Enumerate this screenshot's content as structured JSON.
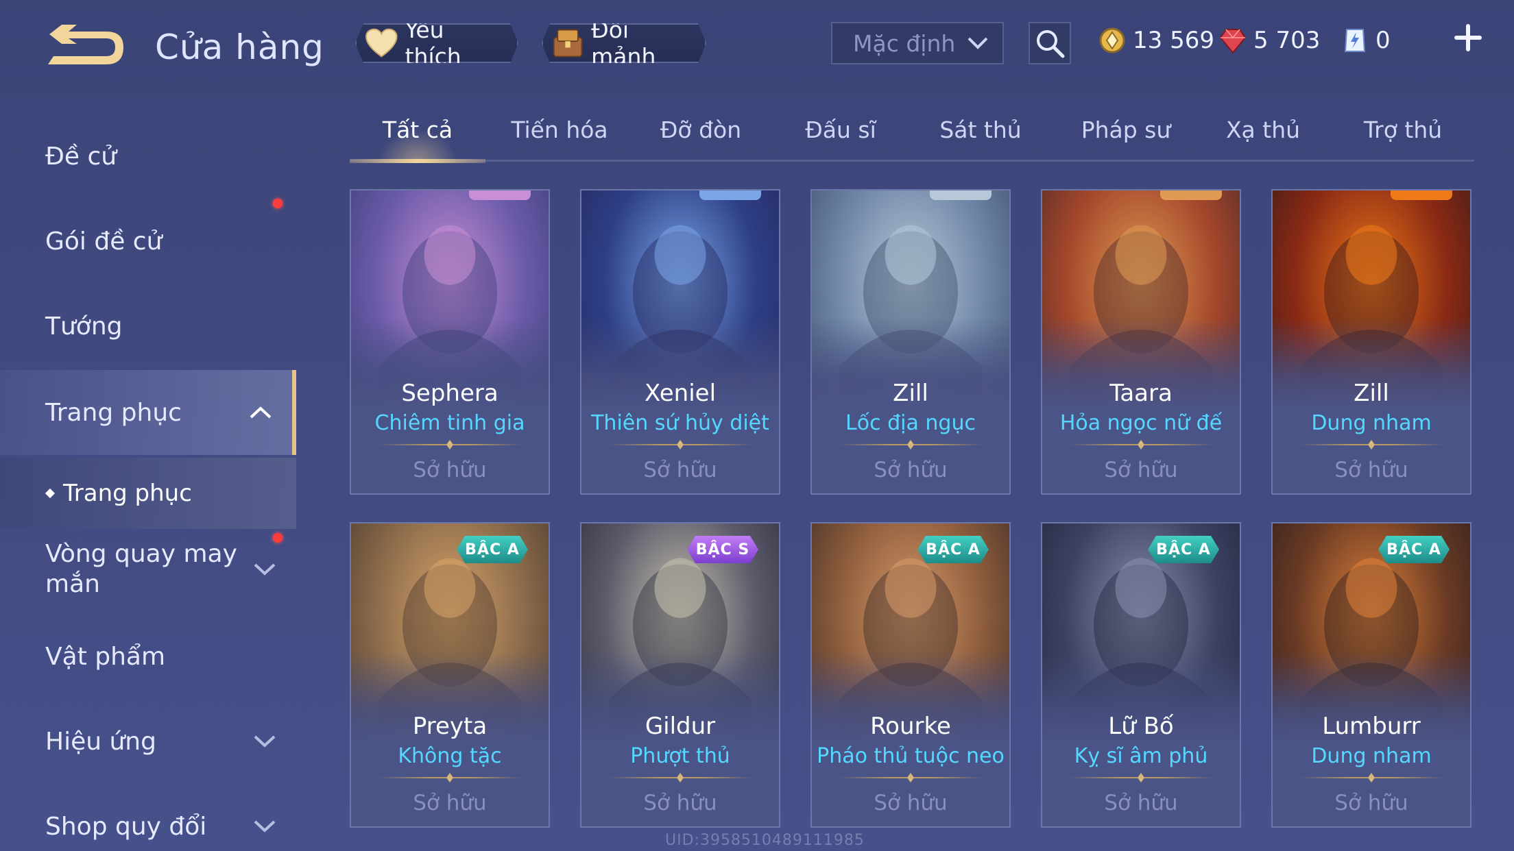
{
  "header": {
    "title": "Cửa hàng",
    "favorites_label": "Yêu thích",
    "exchange_label": "Đổi mảnh",
    "sort": {
      "selected": "Mặc định"
    },
    "currencies": {
      "gold": "13 569",
      "ruby": "5 703",
      "token": "0"
    }
  },
  "sidebar": {
    "items": [
      {
        "label": "Đề cử"
      },
      {
        "label": "Gói đề cử"
      },
      {
        "label": "Tướng"
      },
      {
        "label": "Trang phục"
      },
      {
        "label": "Vòng quay may mắn"
      },
      {
        "label": "Vật phẩm"
      },
      {
        "label": "Hiệu ứng"
      },
      {
        "label": "Shop quy đổi"
      }
    ],
    "sub_item": "Trang phục"
  },
  "tabs": [
    "Tất cả",
    "Tiến hóa",
    "Đỡ đòn",
    "Đấu sĩ",
    "Sát thủ",
    "Pháp sư",
    "Xạ thủ",
    "Trợ thủ"
  ],
  "cards": [
    {
      "hero": "Sephera",
      "skin": "Chiêm tinh gia",
      "status": "Sở hữu",
      "palette": [
        "#6a5aa8",
        "#c98fd6",
        "#3b3f7a"
      ]
    },
    {
      "hero": "Xeniel",
      "skin": "Thiên sứ hủy diệt",
      "status": "Sở hữu",
      "palette": [
        "#2e3f86",
        "#7aa6e8",
        "#26295e"
      ]
    },
    {
      "hero": "Zill",
      "skin": "Lốc địa ngục",
      "status": "Sở hữu",
      "palette": [
        "#6f86a6",
        "#b7c8d8",
        "#3f4f6c"
      ]
    },
    {
      "hero": "Taara",
      "skin": "Hỏa ngọc nữ đế",
      "status": "Sở hữu",
      "palette": [
        "#a4472b",
        "#e09a54",
        "#4f2a2a"
      ]
    },
    {
      "hero": "Zill",
      "skin": "Dung nham",
      "status": "Sở hữu",
      "palette": [
        "#8a2a14",
        "#f07a1a",
        "#3c1b1a"
      ]
    },
    {
      "hero": "Preyta",
      "skin": "Không tặc",
      "status": "Sở hữu",
      "badge": "BẬC A",
      "tier": "A",
      "palette": [
        "#8a6a4a",
        "#d9a46a",
        "#4b3a2e"
      ]
    },
    {
      "hero": "Gildur",
      "skin": "Phượt thủ",
      "status": "Sở hữu",
      "badge": "BẬC S",
      "tier": "S",
      "palette": [
        "#5b5a6a",
        "#c9c3b0",
        "#2f3040"
      ]
    },
    {
      "hero": "Rourke",
      "skin": "Pháo thủ tuộc neo",
      "status": "Sở hữu",
      "badge": "BẬC A",
      "tier": "A",
      "palette": [
        "#8a5a3a",
        "#d89a6a",
        "#3f2e2a"
      ]
    },
    {
      "hero": "Lữ Bố",
      "skin": "Kỵ sĩ âm phủ",
      "status": "Sở hữu",
      "badge": "BẬC A",
      "tier": "A",
      "palette": [
        "#3d4262",
        "#8a8fb0",
        "#24263f"
      ]
    },
    {
      "hero": "Lumburr",
      "skin": "Dung nham",
      "status": "Sở hữu",
      "badge": "BẬC A",
      "tier": "A",
      "palette": [
        "#6a3a24",
        "#e0823a",
        "#2e1f1e"
      ]
    }
  ],
  "watermark": "UID:3958510489111985"
}
